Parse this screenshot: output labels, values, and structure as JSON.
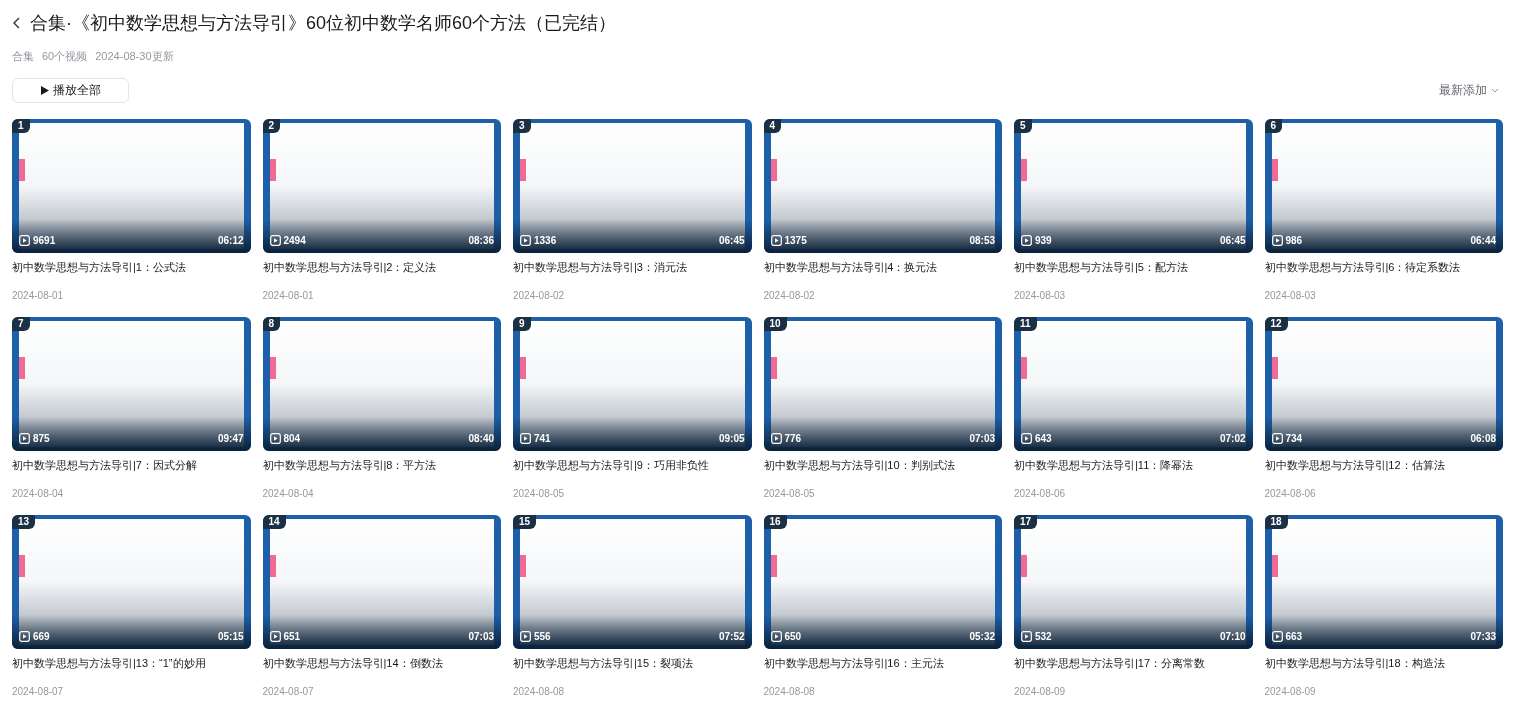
{
  "header": {
    "title": "合集·《初中数学思想与方法导引》60位初中数学名师60个方法（已完结）",
    "meta": [
      "合集",
      "60个视频",
      "2024-08-30更新"
    ]
  },
  "play_all": {
    "label": "播放全部"
  },
  "sort": {
    "label": "最新添加"
  },
  "videos": [
    {
      "index": "1",
      "views": "9691",
      "duration": "06:12",
      "title": "初中数学思想与方法导引|1：公式法",
      "date": "2024-08-01"
    },
    {
      "index": "2",
      "views": "2494",
      "duration": "08:36",
      "title": "初中数学思想与方法导引|2：定义法",
      "date": "2024-08-01"
    },
    {
      "index": "3",
      "views": "1336",
      "duration": "06:45",
      "title": "初中数学思想与方法导引|3：消元法",
      "date": "2024-08-02"
    },
    {
      "index": "4",
      "views": "1375",
      "duration": "08:53",
      "title": "初中数学思想与方法导引|4：换元法",
      "date": "2024-08-02"
    },
    {
      "index": "5",
      "views": "939",
      "duration": "06:45",
      "title": "初中数学思想与方法导引|5：配方法",
      "date": "2024-08-03"
    },
    {
      "index": "6",
      "views": "986",
      "duration": "06:44",
      "title": "初中数学思想与方法导引|6：待定系数法",
      "date": "2024-08-03"
    },
    {
      "index": "7",
      "views": "875",
      "duration": "09:47",
      "title": "初中数学思想与方法导引|7：因式分解",
      "date": "2024-08-04"
    },
    {
      "index": "8",
      "views": "804",
      "duration": "08:40",
      "title": "初中数学思想与方法导引|8：平方法",
      "date": "2024-08-04"
    },
    {
      "index": "9",
      "views": "741",
      "duration": "09:05",
      "title": "初中数学思想与方法导引|9：巧用非负性",
      "date": "2024-08-05"
    },
    {
      "index": "10",
      "views": "776",
      "duration": "07:03",
      "title": "初中数学思想与方法导引|10：判别式法",
      "date": "2024-08-05"
    },
    {
      "index": "11",
      "views": "643",
      "duration": "07:02",
      "title": "初中数学思想与方法导引|11：降幂法",
      "date": "2024-08-06"
    },
    {
      "index": "12",
      "views": "734",
      "duration": "06:08",
      "title": "初中数学思想与方法导引|12：估算法",
      "date": "2024-08-06"
    },
    {
      "index": "13",
      "views": "669",
      "duration": "05:15",
      "title": "初中数学思想与方法导引|13：“1”的妙用",
      "date": "2024-08-07"
    },
    {
      "index": "14",
      "views": "651",
      "duration": "07:03",
      "title": "初中数学思想与方法导引|14：倒数法",
      "date": "2024-08-07"
    },
    {
      "index": "15",
      "views": "556",
      "duration": "07:52",
      "title": "初中数学思想与方法导引|15：裂项法",
      "date": "2024-08-08"
    },
    {
      "index": "16",
      "views": "650",
      "duration": "05:32",
      "title": "初中数学思想与方法导引|16：主元法",
      "date": "2024-08-08"
    },
    {
      "index": "17",
      "views": "532",
      "duration": "07:10",
      "title": "初中数学思想与方法导引|17：分离常数",
      "date": "2024-08-09"
    },
    {
      "index": "18",
      "views": "663",
      "duration": "07:33",
      "title": "初中数学思想与方法导引|18：构造法",
      "date": "2024-08-09"
    }
  ]
}
